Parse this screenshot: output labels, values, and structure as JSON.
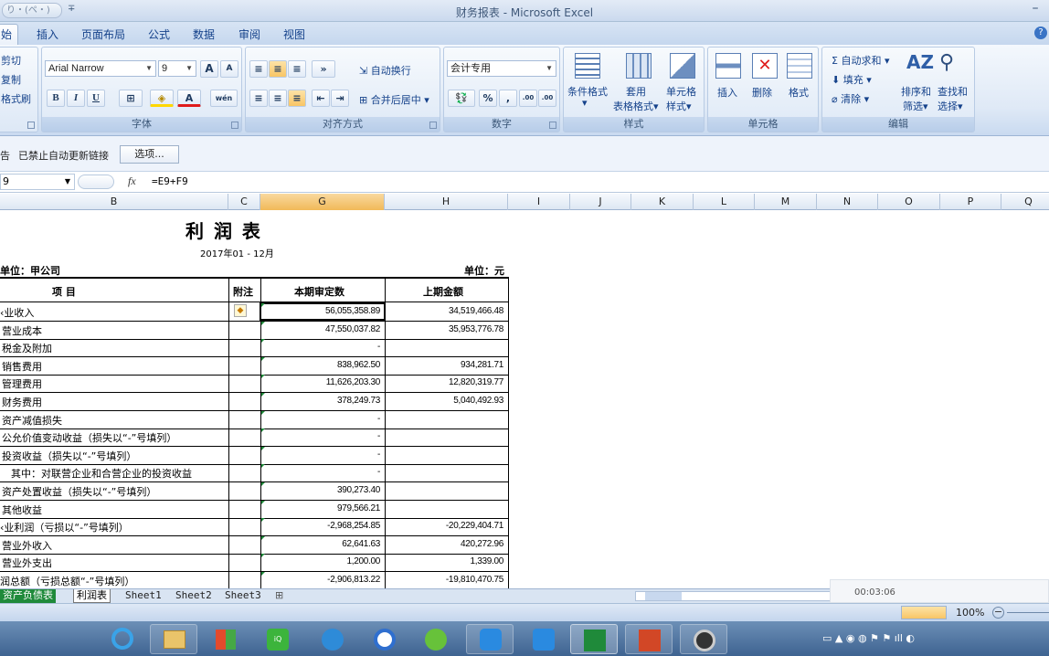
{
  "window": {
    "title": "财务报表 - Microsoft Excel",
    "qat_text": "り・(ペ・)",
    "qat_more": "∓"
  },
  "tabs": [
    "始",
    "插入",
    "页面布局",
    "公式",
    "数据",
    "审阅",
    "视图"
  ],
  "ribbon": {
    "clipboard": {
      "cut": "剪切",
      "copy": "复制",
      "format": "格式刷"
    },
    "font": {
      "name": "Arial Narrow",
      "size": "9",
      "bold": "B",
      "italic": "I",
      "underline": "U",
      "label": "字体",
      "grow": "A",
      "shrink": "A",
      "wen": "wén"
    },
    "alignment": {
      "wrap": "自动换行",
      "merge": "合并后居中",
      "label": "对齐方式"
    },
    "number": {
      "format": "会计专用",
      "label": "数字",
      "percent": "%",
      "comma": ",",
      "inc": ".00",
      "dec": ".00"
    },
    "styles": {
      "cond": "条件格式",
      "table1": "套用",
      "table2": "表格格式",
      "cell1": "单元格",
      "cell2": "样式",
      "label": "样式"
    },
    "cells": {
      "insert": "插入",
      "delete": "删除",
      "format": "格式",
      "label": "单元格"
    },
    "editing": {
      "autosum": "自动求和",
      "fill": "填充",
      "clear": "清除",
      "sort1": "排序和",
      "sort2": "筛选",
      "find1": "查找和",
      "find2": "选择",
      "label": "编辑"
    }
  },
  "message_bar": {
    "warn": "告",
    "text": "已禁止自动更新链接",
    "options_button": "选项..."
  },
  "formula_bar": {
    "name_box": "9",
    "fx": "fx",
    "formula": "=E9+F9"
  },
  "columns": [
    "B",
    "C",
    "G",
    "H",
    "I",
    "J",
    "K",
    "L",
    "M",
    "N",
    "O",
    "P",
    "Q"
  ],
  "report": {
    "title": "利 润 表",
    "period": "2017年01 - 12月",
    "company": "单位：甲公司",
    "unit": "单位：元",
    "headers": {
      "item": "项           目",
      "note": "附注",
      "current": "本期审定数",
      "prior": "上期金额"
    },
    "rows": [
      {
        "label": "‹业收入",
        "current": "56,055,358.89",
        "prior": "34,519,466.48"
      },
      {
        "label": "营业成本",
        "current": "47,550,037.82",
        "prior": "35,953,776.78"
      },
      {
        "label": "税金及附加",
        "current": "-",
        "prior": ""
      },
      {
        "label": "销售费用",
        "current": "838,962.50",
        "prior": "934,281.71"
      },
      {
        "label": "管理费用",
        "current": "11,626,203.30",
        "prior": "12,820,319.77"
      },
      {
        "label": "财务费用",
        "current": "378,249.73",
        "prior": "5,040,492.93"
      },
      {
        "label": "资产减值损失",
        "current": "-",
        "prior": ""
      },
      {
        "label": "公允价值变动收益（损失以“-”号填列）",
        "current": "-",
        "prior": ""
      },
      {
        "label": "投资收益（损失以“-”号填列）",
        "current": "-",
        "prior": ""
      },
      {
        "label": "其中：对联营企业和合营企业的投资收益",
        "current": "-",
        "prior": ""
      },
      {
        "label": "资产处置收益（损失以“-”号填列）",
        "current": "390,273.40",
        "prior": ""
      },
      {
        "label": "其他收益",
        "current": "979,566.21",
        "prior": ""
      },
      {
        "label": "‹业利润（亏损以“-”号填列）",
        "current": "-2,968,254.85",
        "prior": "-20,229,404.71"
      },
      {
        "label": "营业外收入",
        "current": "62,641.63",
        "prior": "420,272.96"
      },
      {
        "label": "营业外支出",
        "current": "1,200.00",
        "prior": "1,339.00"
      },
      {
        "label": "润总额（亏损总额“-”号填列）",
        "current": "-2,906,813.22",
        "prior": "-19,810,470.75"
      }
    ]
  },
  "sheet_tabs": [
    "资产负债表",
    "利润表",
    "Sheet1",
    "Sheet2",
    "Sheet3"
  ],
  "status": {
    "zoom": "100%",
    "timer": "00:03:06"
  },
  "colors": {
    "accent": "#15428b",
    "selected_col": "#f1b958",
    "green_tab": "#1f8a3a"
  }
}
